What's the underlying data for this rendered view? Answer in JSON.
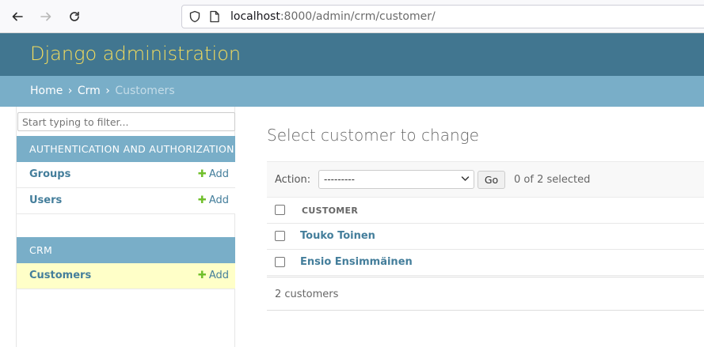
{
  "browser": {
    "url_host": "localhost",
    "url_rest": ":8000/admin/crm/customer/"
  },
  "header": {
    "branding": "Django administration"
  },
  "breadcrumbs": {
    "home": "Home",
    "sep1": "›",
    "app": "Crm",
    "sep2": "›",
    "current": "Customers"
  },
  "sidebar": {
    "filter_placeholder": "Start typing to filter...",
    "modules": [
      {
        "caption": "AUTHENTICATION AND AUTHORIZATION",
        "models": [
          {
            "label": "Groups",
            "add": "Add"
          },
          {
            "label": "Users",
            "add": "Add"
          }
        ]
      },
      {
        "caption": "CRM",
        "models": [
          {
            "label": "Customers",
            "add": "Add"
          }
        ]
      }
    ]
  },
  "main": {
    "title": "Select customer to change",
    "action_label": "Action:",
    "action_selected": "---------",
    "go_label": "Go",
    "selected_count": "0 of 2 selected",
    "column_header": "CUSTOMER",
    "rows": [
      {
        "name": "Touko Toinen"
      },
      {
        "name": "Ensio Ensimmäinen"
      }
    ],
    "paginator": "2 customers"
  },
  "colors": {
    "header_bg": "#417690",
    "branding": "#f5dd5d",
    "breadcrumb_bg": "#79aec8",
    "link": "#447e9b",
    "add_plus": "#70bf2b",
    "current_row": "#ffffc8"
  }
}
